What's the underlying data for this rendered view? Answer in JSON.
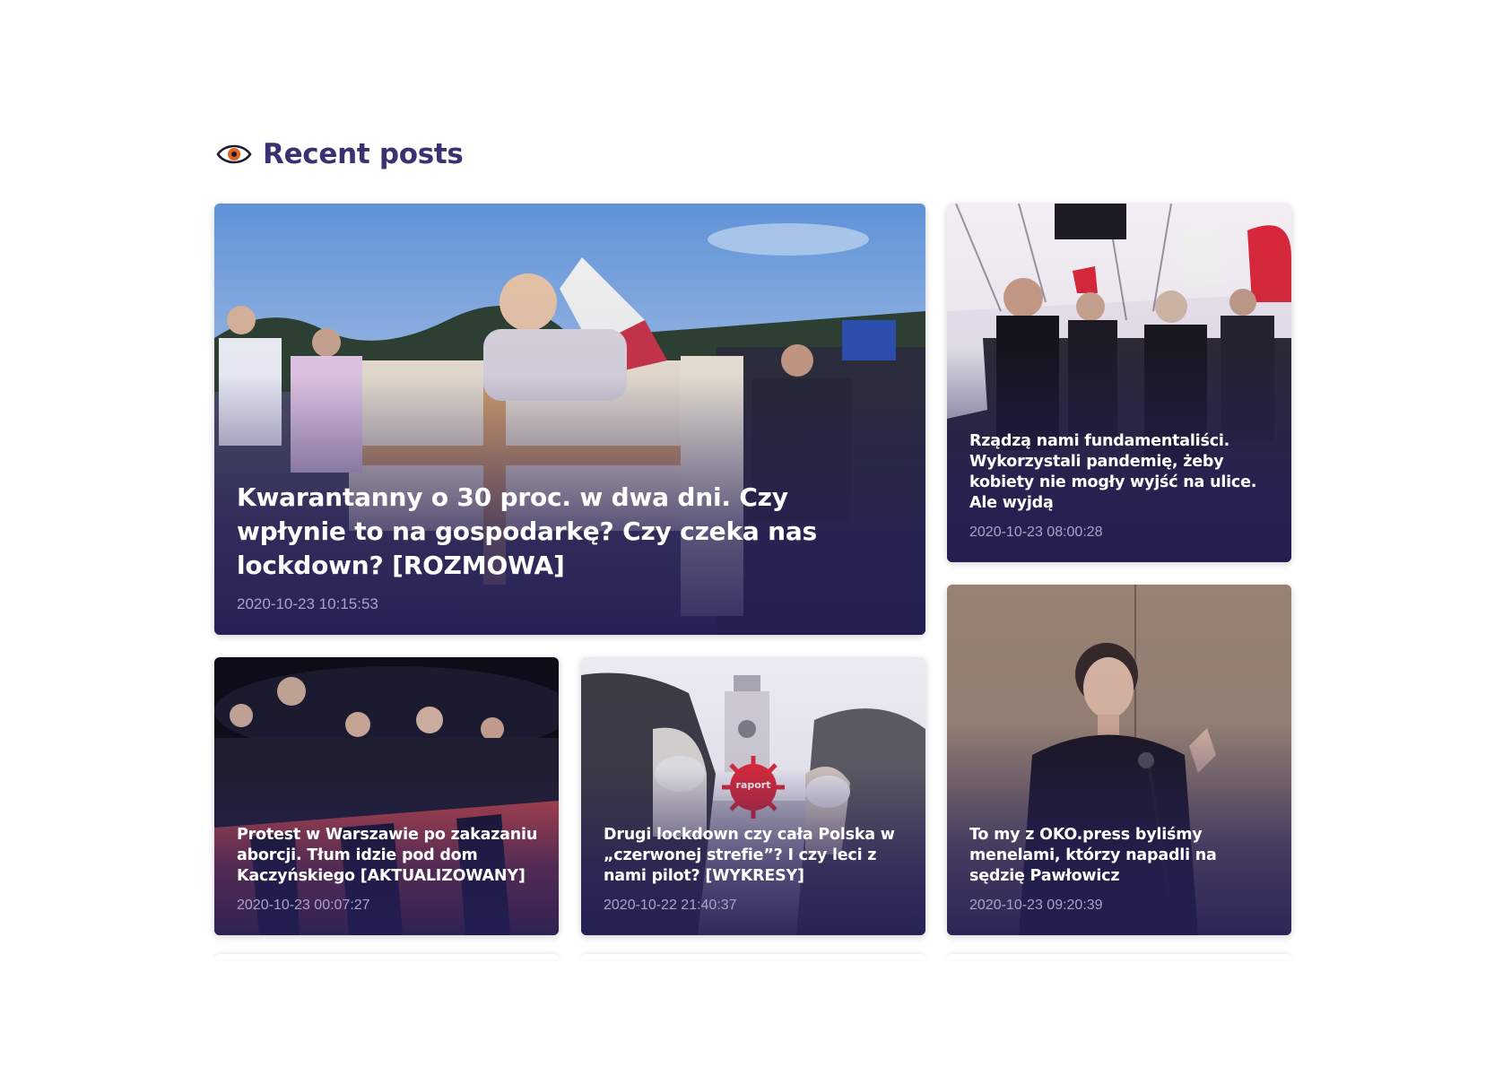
{
  "section": {
    "title": "Recent posts",
    "icon": "eye-icon",
    "accent_color": "#3b3170",
    "icon_color": "#e0641e"
  },
  "posts": [
    {
      "title": "Kwarantanny o 30 proc. w dwa dni. Czy wpłynie to na gospodarkę? Czy czeka nas lockdown? [ROZMOWA]",
      "date": "2020-10-23 10:15:53",
      "image": "protest-signs-medics-flag"
    },
    {
      "title": "Rządzą nami fundamentaliści. Wykorzystali pandemię, żeby kobiety nie mogły wyjść na ulice. Ale wyjdą",
      "date": "2020-10-23 08:00:28",
      "image": "women-protest-masks"
    },
    {
      "title": "Protest w Warszawie po zakazaniu aborcji. Tłum idzie pod dom Kaczyńskiego [AKTUALIZOWANY]",
      "date": "2020-10-23 00:07:27",
      "image": "night-protest-crowd"
    },
    {
      "title": "Drugi lockdown czy cała Polska w „czerwonej strefie”? I czy leci z nami pilot? [WYKRESY]",
      "date": "2020-10-22 21:40:37",
      "image": "masked-people-tower-raport",
      "badge": "raport"
    },
    {
      "title": "To my z OKO.press byliśmy menelami, którzy napadli na sędzię Pawłowicz",
      "date": "2020-10-23 09:20:39",
      "image": "judge-speaking"
    }
  ]
}
